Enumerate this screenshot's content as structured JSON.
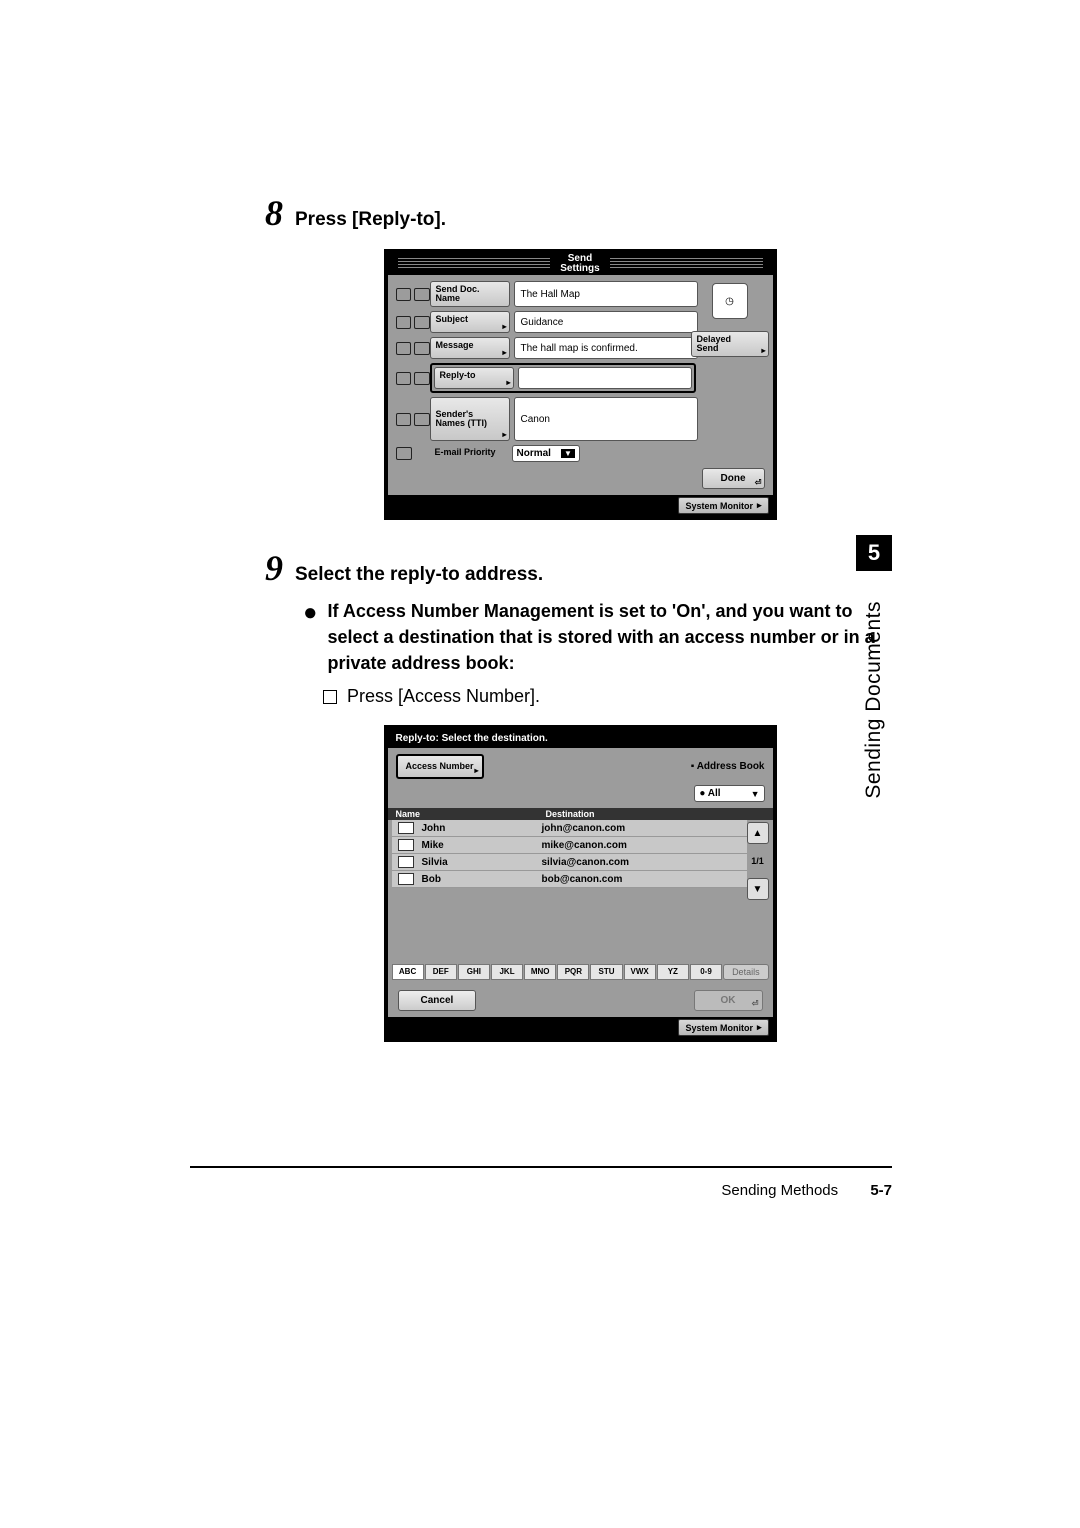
{
  "steps": {
    "s8": {
      "num": "8",
      "title": "Press [Reply-to]."
    },
    "s9": {
      "num": "9",
      "title": "Select the reply-to address.",
      "bullet": "If Access Number Management is set to 'On', and you want to select a destination that is stored with an access number or in a private address book:",
      "checkbox": "Press [Access Number]."
    }
  },
  "shot1": {
    "title_top": "Send",
    "title_bottom": "Settings",
    "rows": {
      "doc_label": "Send Doc.\nName",
      "doc_value": "The Hall Map",
      "subject_label": "Subject",
      "subject_value": "Guidance",
      "message_label": "Message",
      "message_value": "The hall map is confirmed.",
      "reply_label": "Reply-to",
      "reply_value": "",
      "sender_label": "Sender's\nNames (TTI)",
      "sender_value": "Canon",
      "priority_label": "E-mail\nPriority",
      "priority_value": "Normal"
    },
    "delayed_top": "Delayed",
    "delayed_bottom": "Send",
    "done": "Done",
    "sysmon": "System Monitor"
  },
  "shot2": {
    "title": "Reply-to: Select the destination.",
    "access": "Access Number",
    "ab_label": "Address Book",
    "ab_value": "All",
    "col_name": "Name",
    "col_dest": "Destination",
    "rows": [
      {
        "name": "John",
        "dest": "john@canon.com"
      },
      {
        "name": "Mike",
        "dest": "mike@canon.com"
      },
      {
        "name": "Silvia",
        "dest": "silvia@canon.com"
      },
      {
        "name": "Bob",
        "dest": "bob@canon.com"
      }
    ],
    "pager": "1/1",
    "index": [
      "ABC",
      "DEF",
      "GHI",
      "JKL",
      "MNO",
      "PQR",
      "STU",
      "VWX",
      "YZ",
      "0-9"
    ],
    "details": "Details",
    "cancel": "Cancel",
    "ok": "OK",
    "sysmon": "System Monitor"
  },
  "tab": {
    "num": "5",
    "text": "Sending Documents"
  },
  "footer": {
    "section": "Sending Methods",
    "page": "5-7"
  }
}
